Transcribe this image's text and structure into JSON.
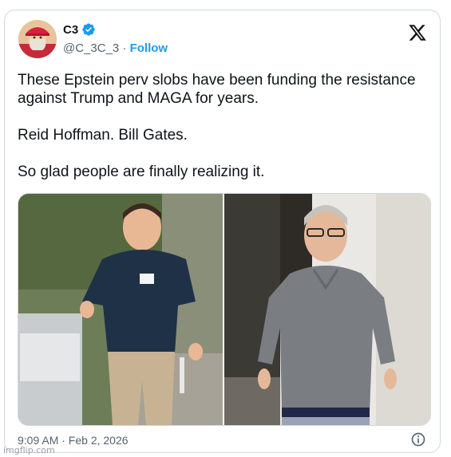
{
  "author": {
    "display_name": "C3",
    "handle": "@C_3C_3",
    "separator": "·",
    "follow_label": "Follow"
  },
  "tweet": {
    "text": "These Epstein perv slobs have been funding the resistance against Trump and MAGA for years.\n\nReid Hoffman. Bill Gates.\n\nSo glad people are finally realizing it.",
    "timestamp": "9:09 AM · Feb 2, 2026"
  },
  "media": {
    "images": [
      "photo-left",
      "photo-right"
    ]
  },
  "icons": {
    "verified": "verified-badge-icon",
    "x_logo": "x-logo-icon",
    "info": "info-icon"
  },
  "colors": {
    "accent": "#1d9bf0",
    "text": "#0f1419",
    "secondary": "#536471",
    "border": "#cfd9de"
  },
  "watermark": "imgflip.com"
}
